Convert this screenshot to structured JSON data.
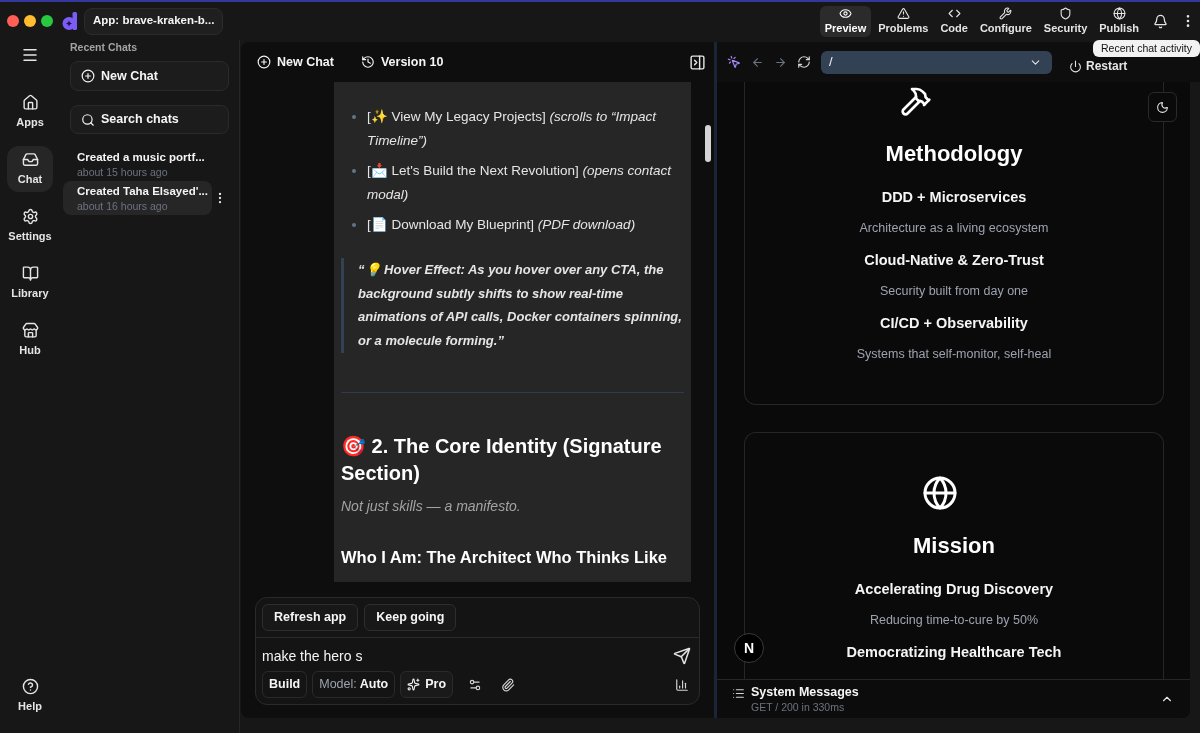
{
  "window": {
    "app_title": "App: brave-kraken-b...",
    "tabs": [
      {
        "label": "Preview",
        "selected": true
      },
      {
        "label": "Problems",
        "selected": false
      },
      {
        "label": "Code",
        "selected": false
      },
      {
        "label": "Configure",
        "selected": false
      },
      {
        "label": "Security",
        "selected": false
      },
      {
        "label": "Publish",
        "selected": false
      }
    ],
    "tooltip": "Recent chat activity"
  },
  "nav_rail": {
    "items": [
      {
        "label": "Apps",
        "selected": false
      },
      {
        "label": "Chat",
        "selected": true
      },
      {
        "label": "Settings",
        "selected": false
      },
      {
        "label": "Library",
        "selected": false
      },
      {
        "label": "Hub",
        "selected": false
      }
    ],
    "help": "Help"
  },
  "sidebar": {
    "title": "Recent Chats",
    "new_chat": "New Chat",
    "search": "Search chats",
    "chats": [
      {
        "title": "Created a music portf...",
        "time": "about 15 hours ago",
        "selected": false
      },
      {
        "title": "Created Taha Elsayed'...",
        "time": "about 16 hours ago",
        "selected": true
      }
    ]
  },
  "chat": {
    "header": {
      "new_chat": "New Chat",
      "version": "Version 10"
    },
    "message": {
      "list_items": [
        "[✨ View My Legacy Projects] *(scrolls to “Impact Timeline”)*",
        "[📩 Let's Build the Next Revolution] *(opens contact modal)*",
        "[📄 Download My Blueprint] *(PDF download)*"
      ],
      "quote": "“💡 Hover Effect: As you hover over any CTA, the background subtly shifts to show real-time animations of API calls, Docker containers spinning, or a molecule forming.”",
      "heading": "🎯 2. The Core Identity (Signature Section)",
      "subtitle": "Not just skills — a manifesto.",
      "subheading": "Who I Am: The Architect Who Thinks Like"
    },
    "composer": {
      "suggestions": [
        "Refresh app",
        "Keep going"
      ],
      "value": "make the hero s",
      "mode": "Build",
      "model_label": "Model:",
      "model": "Auto",
      "pro": "Pro"
    }
  },
  "preview": {
    "url": "/",
    "restart": "Restart",
    "cards": [
      {
        "title": "Methodology",
        "items": [
          {
            "title": "DDD + Microservices",
            "description": "Architecture as a living ecosystem"
          },
          {
            "title": "Cloud-Native & Zero-Trust",
            "description": "Security built from day one"
          },
          {
            "title": "CI/CD + Observability",
            "description": "Systems that self-monitor, self-heal"
          }
        ]
      },
      {
        "title": "Mission",
        "items": [
          {
            "title": "Accelerating Drug Discovery",
            "description": "Reducing time-to-cure by 50%"
          },
          {
            "title": "Democratizing Healthcare Tech"
          }
        ]
      }
    ],
    "dev_badge": "N",
    "system_messages": {
      "title": "System Messages",
      "status": "GET / 200 in 330ms"
    }
  }
}
